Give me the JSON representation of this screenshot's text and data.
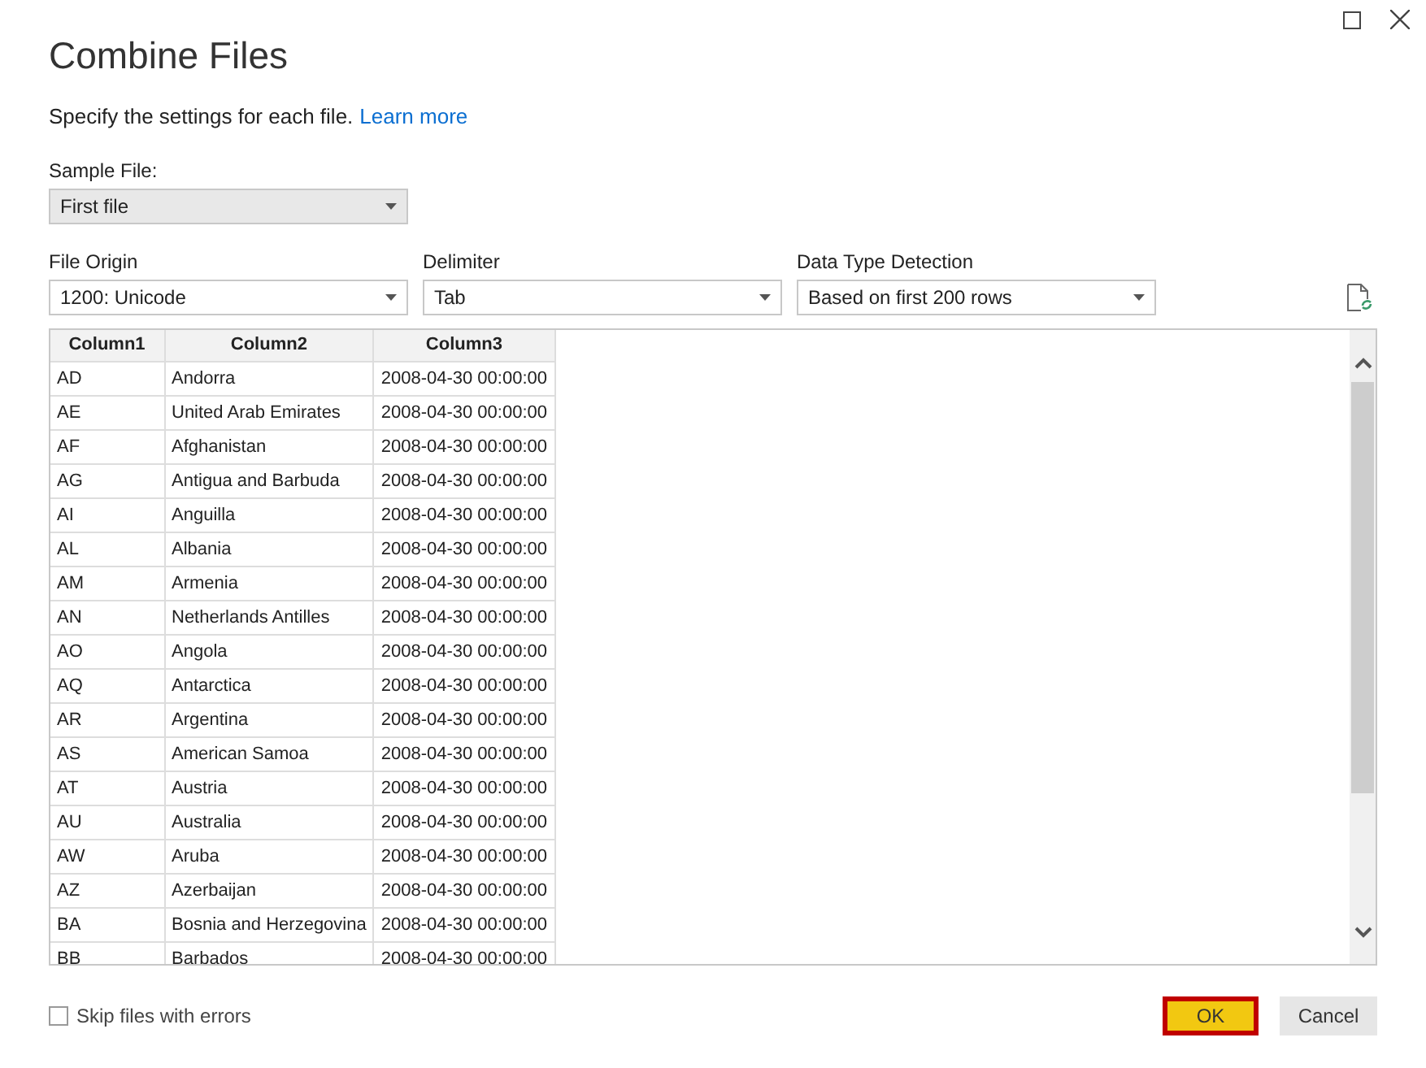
{
  "window": {
    "title": "Combine Files"
  },
  "description": {
    "text": "Specify the settings for each file.",
    "link": "Learn more"
  },
  "sample_file": {
    "label": "Sample File:",
    "value": "First file",
    "disabled": true
  },
  "settings": [
    {
      "label": "File Origin",
      "value": "1200: Unicode"
    },
    {
      "label": "Delimiter",
      "value": "Tab"
    },
    {
      "label": "Data Type Detection",
      "value": "Based on first 200 rows"
    }
  ],
  "table": {
    "columns": [
      "Column1",
      "Column2",
      "Column3"
    ],
    "rows": [
      [
        "AD",
        "Andorra",
        "2008-04-30 00:00:00"
      ],
      [
        "AE",
        "United Arab Emirates",
        "2008-04-30 00:00:00"
      ],
      [
        "AF",
        "Afghanistan",
        "2008-04-30 00:00:00"
      ],
      [
        "AG",
        "Antigua and Barbuda",
        "2008-04-30 00:00:00"
      ],
      [
        "AI",
        "Anguilla",
        "2008-04-30 00:00:00"
      ],
      [
        "AL",
        "Albania",
        "2008-04-30 00:00:00"
      ],
      [
        "AM",
        "Armenia",
        "2008-04-30 00:00:00"
      ],
      [
        "AN",
        "Netherlands Antilles",
        "2008-04-30 00:00:00"
      ],
      [
        "AO",
        "Angola",
        "2008-04-30 00:00:00"
      ],
      [
        "AQ",
        "Antarctica",
        "2008-04-30 00:00:00"
      ],
      [
        "AR",
        "Argentina",
        "2008-04-30 00:00:00"
      ],
      [
        "AS",
        "American Samoa",
        "2008-04-30 00:00:00"
      ],
      [
        "AT",
        "Austria",
        "2008-04-30 00:00:00"
      ],
      [
        "AU",
        "Australia",
        "2008-04-30 00:00:00"
      ],
      [
        "AW",
        "Aruba",
        "2008-04-30 00:00:00"
      ],
      [
        "AZ",
        "Azerbaijan",
        "2008-04-30 00:00:00"
      ],
      [
        "BA",
        "Bosnia and Herzegovina",
        "2008-04-30 00:00:00"
      ],
      [
        "BB",
        "Barbados",
        "2008-04-30 00:00:00"
      ]
    ]
  },
  "skip_errors": {
    "label": "Skip files with errors",
    "checked": false
  },
  "buttons": [
    {
      "label": "OK",
      "kind": "primary"
    },
    {
      "label": "Cancel",
      "kind": "secondary"
    }
  ]
}
